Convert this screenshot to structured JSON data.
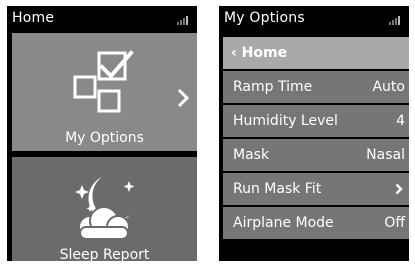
{
  "left_screen": {
    "title": "Home",
    "tiles": [
      {
        "label": "My Options",
        "icon": "options-checkbox-icon"
      },
      {
        "label": "Sleep Report",
        "icon": "moon-cloud-icon"
      }
    ]
  },
  "right_screen": {
    "title": "My Options",
    "back": {
      "label": "Home"
    },
    "items": [
      {
        "label": "Ramp Time",
        "value": "Auto"
      },
      {
        "label": "Humidity Level",
        "value": "4"
      },
      {
        "label": "Mask",
        "value": "Nasal"
      },
      {
        "label": "Run Mask Fit",
        "value": ""
      },
      {
        "label": "Airplane Mode",
        "value": "Off"
      }
    ]
  },
  "colors": {
    "screen_bg": "#000000",
    "tile_light": "#898989",
    "tile_dark": "#6b6b6b",
    "menu_row": "#767676",
    "home_row": "#a9a9a9"
  }
}
